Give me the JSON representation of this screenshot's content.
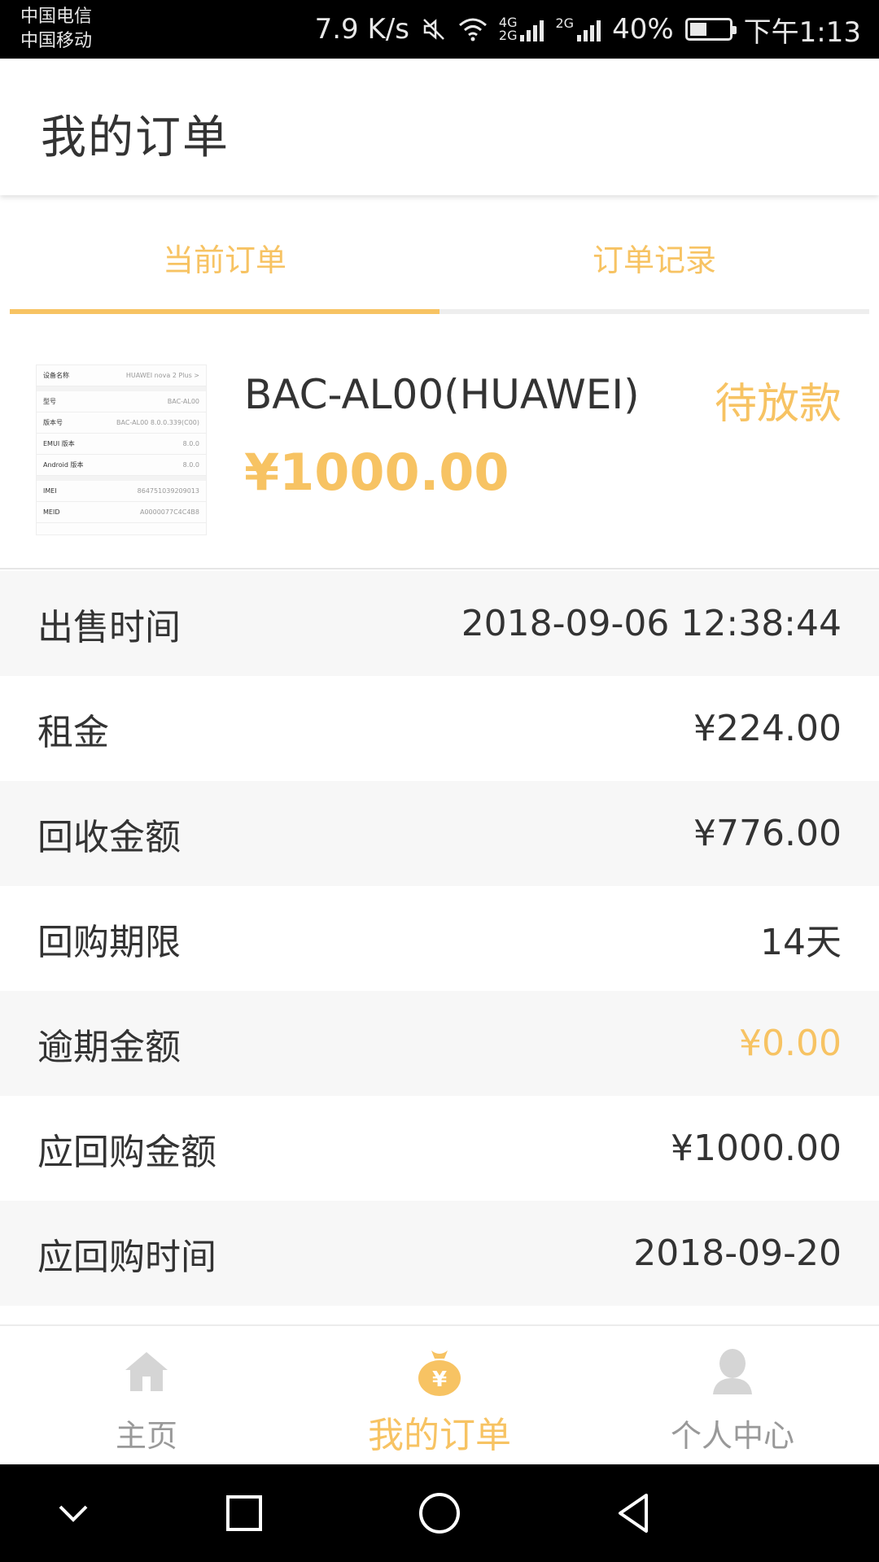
{
  "status_bar": {
    "carrier_1": "中国电信",
    "carrier_2": "中国移动",
    "net_speed": "7.9 K/s",
    "net_type_1": "4G",
    "net_type_1b": "2G",
    "net_type_2": "2G",
    "battery": "40%",
    "battery_level": 0.4,
    "time": "下午1:13"
  },
  "header": {
    "title": "我的订单"
  },
  "tabs": [
    {
      "label": "当前订单",
      "active": true
    },
    {
      "label": "订单记录",
      "active": false
    }
  ],
  "order": {
    "product_name": "BAC-AL00(HUAWEI)",
    "price": "¥1000.00",
    "status": "待放款",
    "thumbnail_rows": [
      {
        "k": "设备名称",
        "v": "HUAWEI nova 2 Plus >"
      },
      {
        "k": "型号",
        "v": "BAC-AL00"
      },
      {
        "k": "版本号",
        "v": "BAC-AL00 8.0.0.339(C00)"
      },
      {
        "k": "EMUI 版本",
        "v": "8.0.0"
      },
      {
        "k": "Android 版本",
        "v": "8.0.0"
      },
      {
        "k": "IMEI",
        "v": "864751039209013"
      },
      {
        "k": "MEID",
        "v": "A0000077C4C4B8"
      }
    ]
  },
  "details": [
    {
      "label": "出售时间",
      "value": "2018-09-06 12:38:44",
      "accent": false
    },
    {
      "label": "租金",
      "value": "¥224.00",
      "accent": false
    },
    {
      "label": "回收金额",
      "value": "¥776.00",
      "accent": false
    },
    {
      "label": "回购期限",
      "value": "14天",
      "accent": false
    },
    {
      "label": "逾期金额",
      "value": "¥0.00",
      "accent": true
    },
    {
      "label": "应回购金额",
      "value": "¥1000.00",
      "accent": false
    },
    {
      "label": "应回购时间",
      "value": "2018-09-20",
      "accent": false
    }
  ],
  "bottom_nav": [
    {
      "label": "主页",
      "icon": "home-icon",
      "active": false
    },
    {
      "label": "我的订单",
      "icon": "money-bag-icon",
      "active": true
    },
    {
      "label": "个人中心",
      "icon": "user-icon",
      "active": false
    }
  ],
  "colors": {
    "accent": "#f7c363",
    "text": "#333333",
    "muted": "#999999",
    "row_alt": "#f7f7f7"
  }
}
